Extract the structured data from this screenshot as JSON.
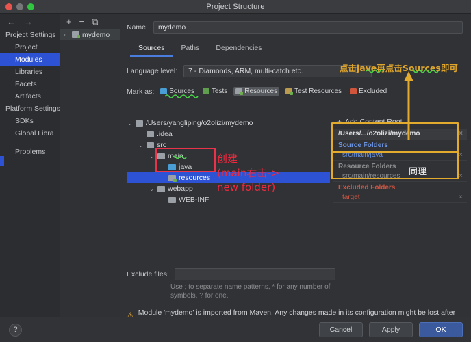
{
  "window": {
    "title": "Project Structure"
  },
  "nav": {
    "back_icon": "arrow-left-icon",
    "forward_icon": "arrow-right-icon",
    "groups": [
      {
        "label": "Project Settings",
        "items": [
          {
            "label": "Project",
            "selected": false
          },
          {
            "label": "Modules",
            "selected": true
          },
          {
            "label": "Libraries",
            "selected": false
          },
          {
            "label": "Facets",
            "selected": false
          },
          {
            "label": "Artifacts",
            "selected": false
          }
        ]
      },
      {
        "label": "Platform Settings",
        "items": [
          {
            "label": "SDKs",
            "selected": false
          },
          {
            "label": "Global Libra",
            "selected": false
          }
        ]
      }
    ],
    "problems": "Problems"
  },
  "modules": {
    "toolbar": {
      "add": "+",
      "remove": "−",
      "copy": "⧉"
    },
    "items": [
      {
        "label": "mydemo",
        "selected": true,
        "expand": "›"
      }
    ]
  },
  "main": {
    "name_label": "Name:",
    "name_value": "mydemo",
    "tabs": [
      {
        "label": "Sources",
        "active": true
      },
      {
        "label": "Paths",
        "active": false
      },
      {
        "label": "Dependencies",
        "active": false
      }
    ],
    "language_label": "Language level:",
    "language_value": "7 - Diamonds, ARM, multi-catch etc.",
    "mark_as_label": "Mark as:",
    "mark_as": [
      {
        "label": "Sources",
        "color": "#4a9ed6",
        "highlighted": false
      },
      {
        "label": "Tests",
        "color": "#5f9e4e",
        "highlighted": false
      },
      {
        "label": "Resources",
        "color": "#9aa0a6",
        "highlighted": true
      },
      {
        "label": "Test Resources",
        "color": "#b99a4e",
        "highlighted": false
      },
      {
        "label": "Excluded",
        "color": "#d1553a",
        "highlighted": false
      }
    ],
    "tree": [
      {
        "label": "/Users/yangliping/o2olizi/mydemo",
        "indent": 0,
        "arrow": "⌄",
        "icon": "folder",
        "selected": false
      },
      {
        "label": ".idea",
        "indent": 1,
        "arrow": "",
        "icon": "folder",
        "selected": false
      },
      {
        "label": "src",
        "indent": 1,
        "arrow": "⌄",
        "icon": "folder",
        "selected": false
      },
      {
        "label": "main",
        "indent": 2,
        "arrow": "⌄",
        "icon": "folder",
        "selected": false
      },
      {
        "label": "java",
        "indent": 3,
        "arrow": "",
        "icon": "folder-blue",
        "selected": false
      },
      {
        "label": "resources",
        "indent": 3,
        "arrow": "",
        "icon": "folder-resource",
        "selected": true
      },
      {
        "label": "webapp",
        "indent": 2,
        "arrow": "⌄",
        "icon": "folder",
        "selected": false
      },
      {
        "label": "WEB-INF",
        "indent": 3,
        "arrow": "",
        "icon": "folder",
        "selected": false
      }
    ],
    "add_content_root": "Add Content Root",
    "content_root_path": "/Users/.../o2olizi/mydemo",
    "folder_groups": [
      {
        "title": "Source Folders",
        "kind": "src",
        "paths": [
          "src/main/java"
        ]
      },
      {
        "title": "Resource Folders",
        "kind": "resf",
        "paths": [
          "src/main/resources"
        ]
      },
      {
        "title": "Excluded Folders",
        "kind": "exc",
        "paths": [
          "target"
        ]
      }
    ],
    "exclude_label": "Exclude files:",
    "exclude_value": "",
    "exclude_hint": "Use ; to separate name patterns, * for any number of symbols, ? for one.",
    "warning_icon": "warning-triangle-icon",
    "warning_text": "Module 'mydemo' is imported from Maven. Any changes made in its configuration might be lost after reimporting."
  },
  "annotations": {
    "gold_top": "点击jave再点击Sources即可",
    "red_line1": "创建",
    "red_line2": "(main右击->",
    "red_line3": "new folder)",
    "tongli": "同理",
    "arrow_icon": "arrow-up-icon",
    "colors": {
      "gold": "#e0a62c",
      "red": "#f0293f",
      "green_squiggle": "#49d24a"
    }
  },
  "footer": {
    "help_label": "?",
    "buttons": [
      {
        "label": "Cancel",
        "primary": false
      },
      {
        "label": "Apply",
        "primary": false
      },
      {
        "label": "OK",
        "primary": true
      }
    ]
  }
}
